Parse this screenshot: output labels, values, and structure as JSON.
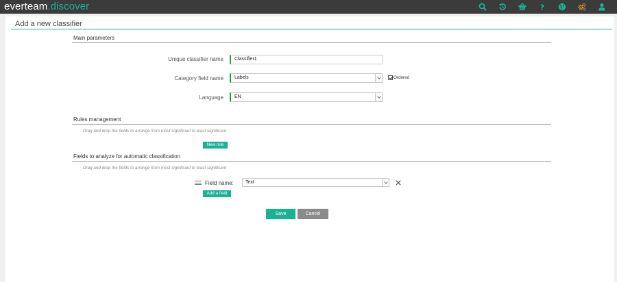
{
  "app": {
    "brand_part1": "everteam",
    "brand_part2": ".discover",
    "accent_color": "#19b394",
    "header_bg": "#3b3b3b",
    "icons": [
      "search-icon",
      "history-icon",
      "basket-icon",
      "help-icon",
      "globe-icon",
      "settings-icon",
      "user-icon"
    ]
  },
  "page": {
    "title": "Add a new classifier"
  },
  "main_parameters": {
    "title": "Main parameters",
    "classifier_name_label": "Unique classifier name",
    "classifier_name_value": "Classifier1",
    "category_field_label": "Category field name",
    "category_field_value": "Labels",
    "ordered_label": "Ordered",
    "ordered_checked": true,
    "language_label": "Language",
    "language_value": "EN"
  },
  "rules": {
    "title": "Rules management",
    "hint": "Drag and drop the fields to arrange from most significant to least significant",
    "new_rule_label": "New rule"
  },
  "fields": {
    "title": "Fields to analyze for automatic classification",
    "hint": "Drag and drop the fields to arrange from most significant to least significant",
    "field_name_label": "Field name:",
    "field_name_value": "Text",
    "add_field_label": "Add a field"
  },
  "actions": {
    "save_label": "Save",
    "cancel_label": "Cancel"
  }
}
